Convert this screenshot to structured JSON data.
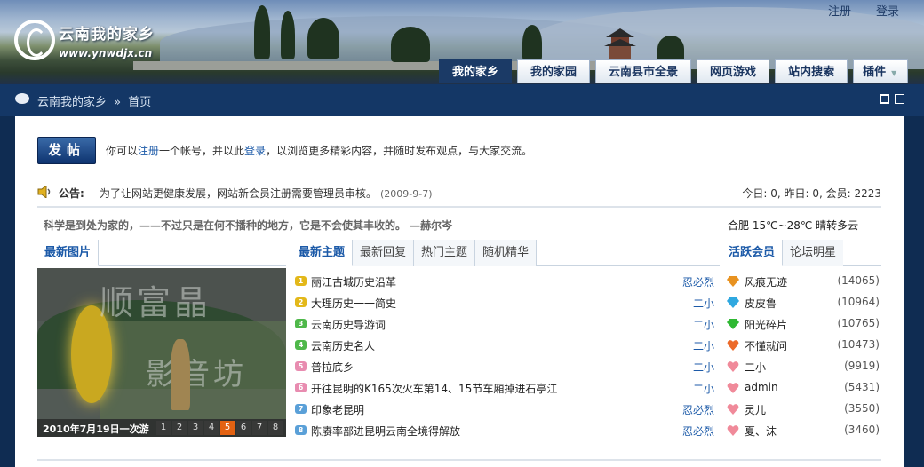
{
  "site": {
    "title": "云南我的家乡",
    "url": "www.ynwdjx.cn"
  },
  "top_links": [
    "注册",
    "登录"
  ],
  "nav": [
    {
      "label": "我的家乡",
      "active": true
    },
    {
      "label": "我的家园",
      "active": false
    },
    {
      "label": "云南县市全景",
      "active": false
    },
    {
      "label": "网页游戏",
      "active": false
    },
    {
      "label": "站内搜索",
      "active": false
    },
    {
      "label": "插件",
      "active": false
    }
  ],
  "breadcrumb": {
    "site": "云南我的家乡",
    "sep": "»",
    "page": "首页"
  },
  "post_button": "发帖",
  "welcome": {
    "prefix": "你可以",
    "register": "注册",
    "mid": "一个帐号，并以此",
    "login": "登录",
    "suffix": "，以浏览更多精彩内容，并随时发布观点，与大家交流。"
  },
  "notice": {
    "label": "公告:",
    "text": "为了让网站更健康发展，网站新会员注册需要管理员审核。",
    "date": "(2009-9-7)"
  },
  "stats": "今日: 0, 昨日: 0, 会员: 2223",
  "quote": "科学是到处为家的，——不过只是在何不播种的地方，它是不会使其丰收的。 —赫尔岑",
  "weather": {
    "text": "合肥  15℃~28℃ 晴转多云",
    "dash": "—"
  },
  "photo": {
    "tab": "最新图片",
    "caption": "2010年7月19日一次游",
    "pages": [
      "1",
      "2",
      "3",
      "4",
      "5",
      "6",
      "7",
      "8"
    ],
    "current_page": "5"
  },
  "topic_tabs": [
    "最新主题",
    "最新回复",
    "热门主题",
    "随机精华"
  ],
  "topics": [
    {
      "n": "1",
      "title": "丽江古城历史沿革",
      "author": "忍必烈",
      "color": "#e3b81a"
    },
    {
      "n": "2",
      "title": "大理历史一一简史",
      "author": "二小",
      "color": "#e3b81a"
    },
    {
      "n": "3",
      "title": "云南历史导游词",
      "author": "二小",
      "color": "#4fb84a"
    },
    {
      "n": "4",
      "title": "云南历史名人",
      "author": "二小",
      "color": "#4fb84a"
    },
    {
      "n": "5",
      "title": "普拉底乡",
      "author": "二小",
      "color": "#e88cb0"
    },
    {
      "n": "6",
      "title": "开往昆明的K165次火车第14、15节车厢掉进石亭江",
      "author": "二小",
      "color": "#e88cb0"
    },
    {
      "n": "7",
      "title": "印象老昆明",
      "author": "忍必烈",
      "color": "#5aa0d8"
    },
    {
      "n": "8",
      "title": "陈赓率部进昆明云南全境得解放",
      "author": "忍必烈",
      "color": "#5aa0d8"
    }
  ],
  "member_tabs": [
    "活跃会员",
    "论坛明星"
  ],
  "members": [
    {
      "name": "风痕无迹",
      "score": "(14065)",
      "icon": "orange-diamond-icon",
      "color": "#e89220"
    },
    {
      "name": "皮皮鲁",
      "score": "(10964)",
      "icon": "blue-diamond-icon",
      "color": "#2fa8e0"
    },
    {
      "name": "阳光碎片",
      "score": "(10765)",
      "icon": "green-diamond-icon",
      "color": "#2fb833"
    },
    {
      "name": "不懂就问",
      "score": "(10473)",
      "icon": "orange-heart-icon",
      "color": "#ec6a2a"
    },
    {
      "name": "二小",
      "score": "(9919)",
      "icon": "pink-heart-icon",
      "color": "#f08a9a"
    },
    {
      "name": "admin",
      "score": "(5431)",
      "icon": "pink-heart-icon",
      "color": "#f08a9a"
    },
    {
      "name": "灵儿",
      "score": "(3550)",
      "icon": "pink-heart-icon",
      "color": "#f08a9a"
    },
    {
      "name": "夏、沫",
      "score": "(3460)",
      "icon": "pink-heart-icon",
      "color": "#f08a9a"
    }
  ]
}
